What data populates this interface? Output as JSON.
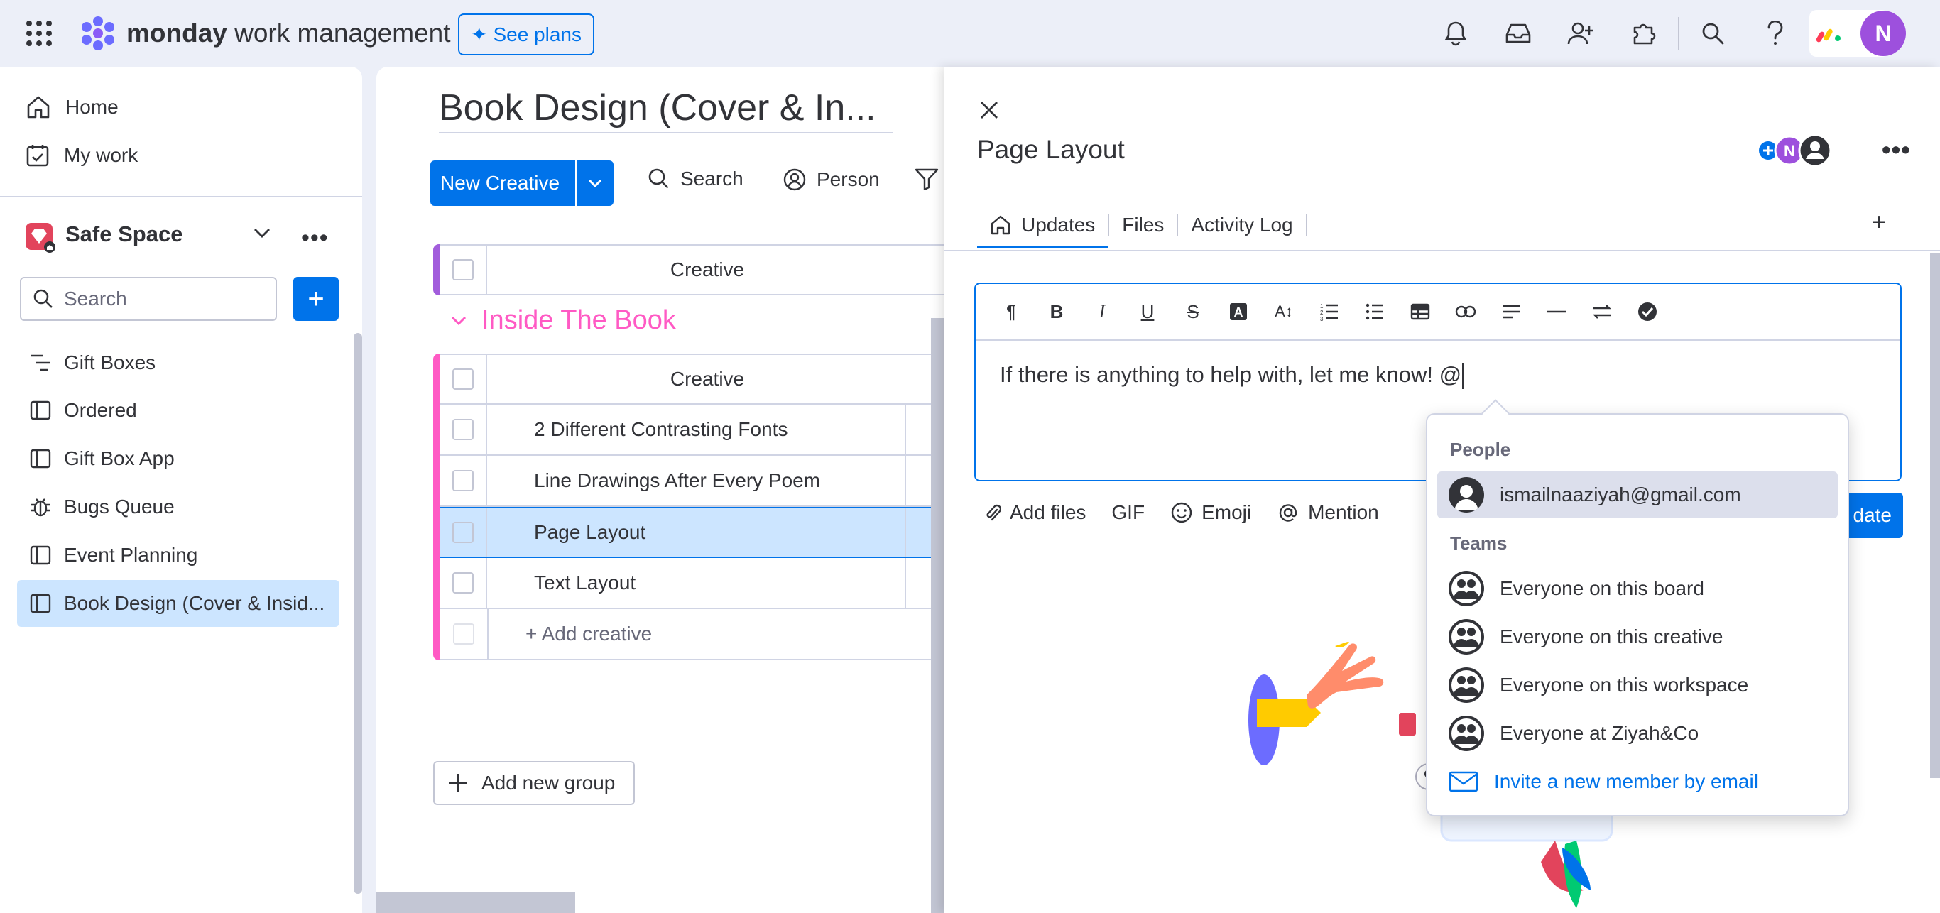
{
  "app": {
    "brand_bold": "monday",
    "brand_rest": " work management",
    "see_plans": "See plans",
    "user_initial": "N"
  },
  "sidebar": {
    "home": "Home",
    "my_work": "My work",
    "workspace": "Safe Space",
    "search_placeholder": "Search",
    "add": "+",
    "boards": [
      {
        "label": "Gift Boxes",
        "icon": "gantt-icon"
      },
      {
        "label": "Ordered",
        "icon": "board-icon"
      },
      {
        "label": "Gift Box App",
        "icon": "board-icon"
      },
      {
        "label": "Bugs Queue",
        "icon": "bug-icon"
      },
      {
        "label": "Event Planning",
        "icon": "board-icon"
      },
      {
        "label": "Book Design (Cover & Insid...",
        "icon": "board-icon"
      }
    ]
  },
  "board": {
    "title": "Book Design (Cover & In...",
    "new_item": "New Creative",
    "search": "Search",
    "person": "Person",
    "column_header": "Creative",
    "group_name": "Inside The Book",
    "items": [
      "2 Different Contrasting Fonts",
      "Line Drawings After Every Poem",
      "Page Layout",
      "Text Layout"
    ],
    "add_item": "+ Add creative",
    "add_group": "Add new group"
  },
  "panel": {
    "title": "Page Layout",
    "avatar_initial": "N",
    "tabs": [
      "Updates",
      "Files",
      "Activity Log"
    ],
    "tab_add": "+",
    "editor_text": "If there is anything to help with, let me know! @",
    "toolbar": [
      "¶",
      "B",
      "I",
      "U",
      "S",
      "A",
      "A↕"
    ],
    "actions": {
      "add_files": "Add files",
      "gif": "GIF",
      "emoji": "Emoji",
      "mention": "Mention",
      "update": "date"
    }
  },
  "mention": {
    "people_header": "People",
    "people": [
      "ismailnaaziyah@gmail.com"
    ],
    "teams_header": "Teams",
    "teams": [
      "Everyone on this board",
      "Everyone on this creative",
      "Everyone on this workspace",
      "Everyone at Ziyah&Co"
    ],
    "invite": "Invite a new member by email"
  },
  "colors": {
    "accent": "#0073ea",
    "group_pink": "#ff5ac4",
    "purple_bar": "#a25ddc",
    "selected_row": "#cce5ff",
    "avatar": "#9d50dd"
  }
}
